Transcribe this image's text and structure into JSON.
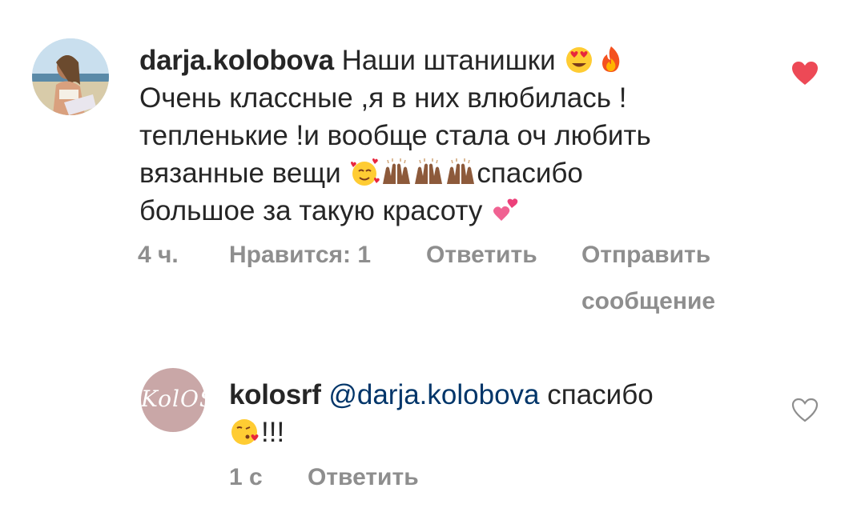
{
  "comments": [
    {
      "username": "darja.kolobova",
      "line1_text": "Наши штанишки",
      "line2": "Очень классные ,я в них влюбилась !",
      "line3": "тепленькие !и вообще стала оч любить",
      "line4_text": "вязанные вещи",
      "line4_after": "спасибо",
      "line5_text": "большое за такую красоту",
      "time": "4 ч.",
      "likes": "Нравится: 1",
      "reply": "Ответить",
      "send_line1": "Отправить",
      "send_line2": "сообщение",
      "liked": true
    },
    {
      "username": "kolosrf",
      "mention": "@darja.kolobova",
      "text": "спасибо",
      "exclaim": "!!!",
      "time": "1 с",
      "reply": "Ответить",
      "liked": false
    }
  ],
  "colors": {
    "like_red": "#ed4956",
    "meta_gray": "#8e8e8e",
    "mention_blue": "#003569"
  }
}
